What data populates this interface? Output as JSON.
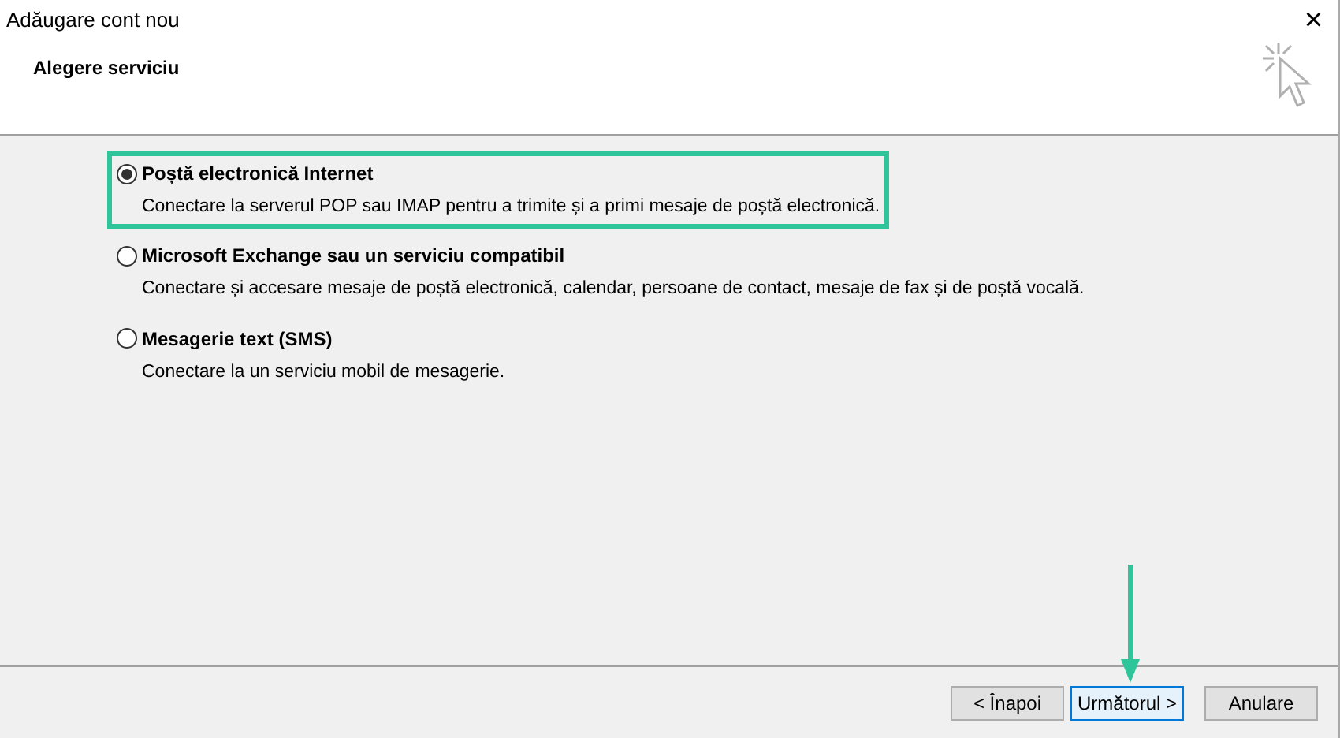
{
  "window": {
    "title": "Adăugare cont nou",
    "close": "×"
  },
  "header": {
    "title": "Alegere serviciu"
  },
  "options": [
    {
      "label": "Poștă electronică Internet",
      "description": "Conectare la serverul POP sau IMAP pentru a trimite și a primi mesaje de poștă electronică.",
      "selected": true
    },
    {
      "label": "Microsoft Exchange sau un serviciu compatibil",
      "description": "Conectare și accesare mesaje de poștă electronică, calendar, persoane de contact, mesaje de fax și de poștă vocală.",
      "selected": false
    },
    {
      "label": "Mesagerie text (SMS)",
      "description": "Conectare la un serviciu mobil de mesagerie.",
      "selected": false
    }
  ],
  "buttons": [
    {
      "label": "< Înapoi",
      "default": false
    },
    {
      "label": "Următorul >",
      "default": true
    },
    {
      "label": "Anulare",
      "default": false
    }
  ]
}
